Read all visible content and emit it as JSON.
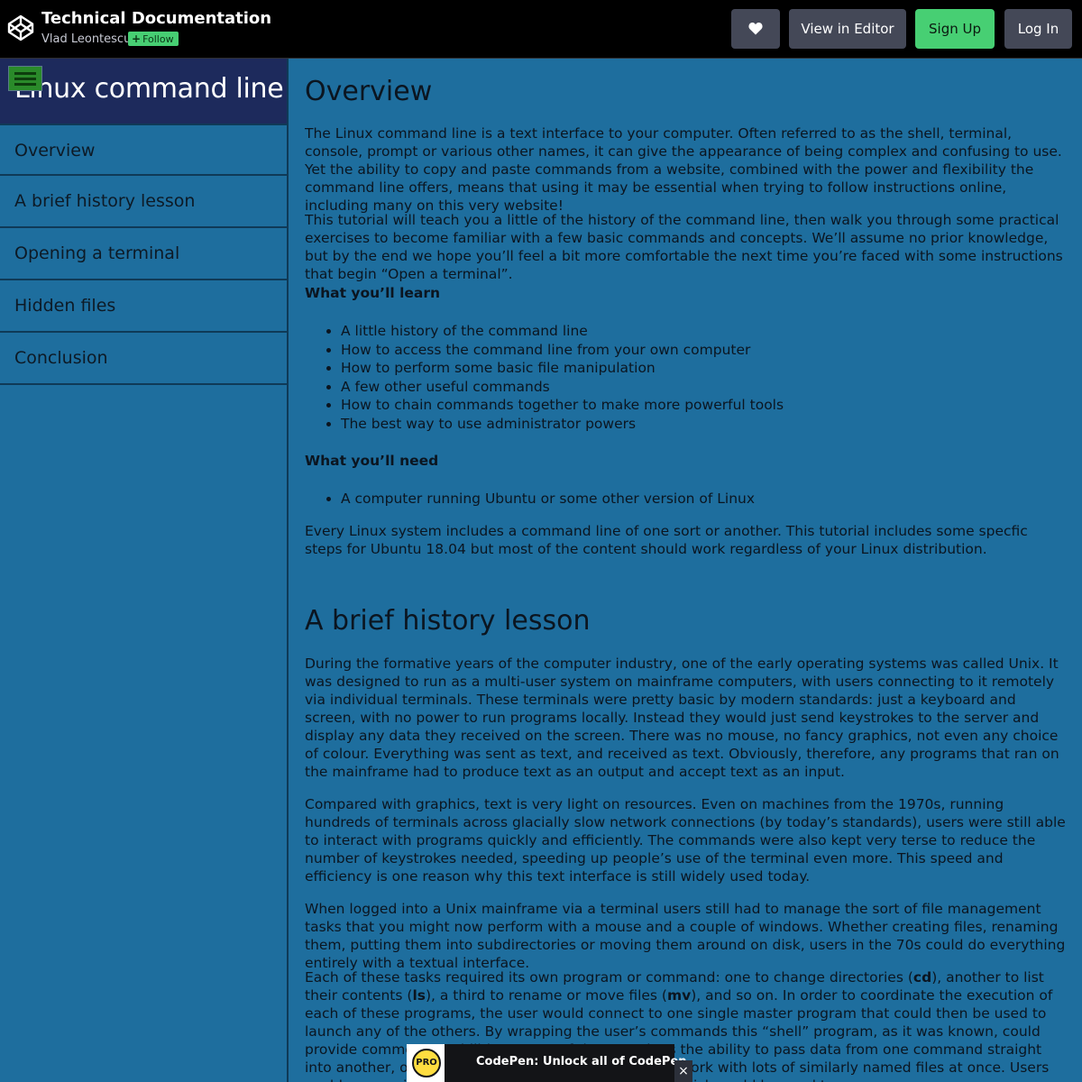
{
  "codepen": {
    "pen_title": "Technical Documentation",
    "author": "Vlad Leontescu",
    "follow_label": "Follow",
    "buttons": {
      "heart_icon": "heart-icon",
      "view_in_editor": "View in Editor",
      "sign_up": "Sign Up",
      "log_in": "Log In"
    },
    "colors": {
      "bar": "#000000",
      "green": "#47cf73",
      "button": "#444857"
    }
  },
  "sidebar": {
    "title": "Linux command line",
    "menu_icon": "hamburger-menu-icon",
    "items": [
      {
        "label": "Overview"
      },
      {
        "label": "A brief history lesson"
      },
      {
        "label": "Opening a terminal"
      },
      {
        "label": "Hidden files"
      },
      {
        "label": "Conclusion"
      }
    ]
  },
  "main": {
    "overview": {
      "heading": "Overview",
      "p1": "The Linux command line is a text interface to your computer. Often referred to as the shell, terminal, console, prompt or various other names, it can give the appearance of being complex and confusing to use. Yet the ability to copy and paste commands from a website, combined with the power and flexibility the command line offers, means that using it may be essential when trying to follow instructions online, including many on this very website!",
      "p2": "This tutorial will teach you a little of the history of the command line, then walk you through some practical exercises to become familiar with a few basic commands and concepts. We’ll assume no prior knowledge, but by the end we hope you’ll feel a bit more comfortable the next time you’re faced with some instructions that begin “Open a terminal”.",
      "learn_heading": "What you’ll learn",
      "learn_items": [
        "A little history of the command line",
        "How to access the command line from your own computer",
        "How to perform some basic file manipulation",
        "A few other useful commands",
        "How to chain commands together to make more powerful tools",
        "The best way to use administrator powers"
      ],
      "need_heading": "What you’ll need",
      "need_items": [
        "A computer running Ubuntu or some other version of Linux"
      ],
      "p3": "Every Linux system includes a command line of one sort or another. This tutorial includes some specfic steps for Ubuntu 18.04 but most of the content should work regardless of your Linux distribution."
    },
    "history": {
      "heading": "A brief history lesson",
      "p1": "During the formative years of the computer industry, one of the early operating systems was called Unix. It was designed to run as a multi-user system on mainframe computers, with users connecting to it remotely via individual terminals. These terminals were pretty basic by modern standards: just a keyboard and screen, with no power to run programs locally. Instead they would just send keystrokes to the server and display any data they received on the screen. There was no mouse, no fancy graphics, not even any choice of colour. Everything was sent as text, and received as text. Obviously, therefore, any programs that ran on the mainframe had to produce text as an output and accept text as an input.",
      "p2": "Compared with graphics, text is very light on resources. Even on machines from the 1970s, running hundreds of terminals across glacially slow network connections (by today’s standards), users were still able to interact with programs quickly and efficiently. The commands were also kept very terse to reduce the number of keystrokes needed, speeding up people’s use of the terminal even more. This speed and efficiency is one reason why this text interface is still widely used today.",
      "p3": "When logged into a Unix mainframe via a terminal users still had to manage the sort of file management tasks that you might now perform with a mouse and a couple of windows. Whether creating files, renaming them, putting them into subdirectories or moving them around on disk, users in the 70s could do everything entirely with a textual interface.",
      "p4_a": "Each of these tasks required its own program or command: one to change directories (",
      "cmd_cd": "cd",
      "p4_b": "), another to list their contents (",
      "cmd_ls": "ls",
      "p4_c": "), a third to rename or move files (",
      "cmd_mv": "mv",
      "p4_d": "), and so on. In order to coordinate the execution of each of these programs, the user would connect to one single master program that could then be used to launch any of the others. By wrapping the user’s commands this “shell” program, as it was known, could provide common capabilities to any of them, such as the ability to pass data from one command straight into another, or to use special wildcard characters to work with lots of similarly named files at once. Users could even write simple code (called “shell scripts”) which could be used to"
    }
  },
  "pro_banner": {
    "badge": "PRO",
    "text": "CodePen: Unlock all of CodePen",
    "close_icon": "close-icon",
    "close_glyph": "×"
  }
}
